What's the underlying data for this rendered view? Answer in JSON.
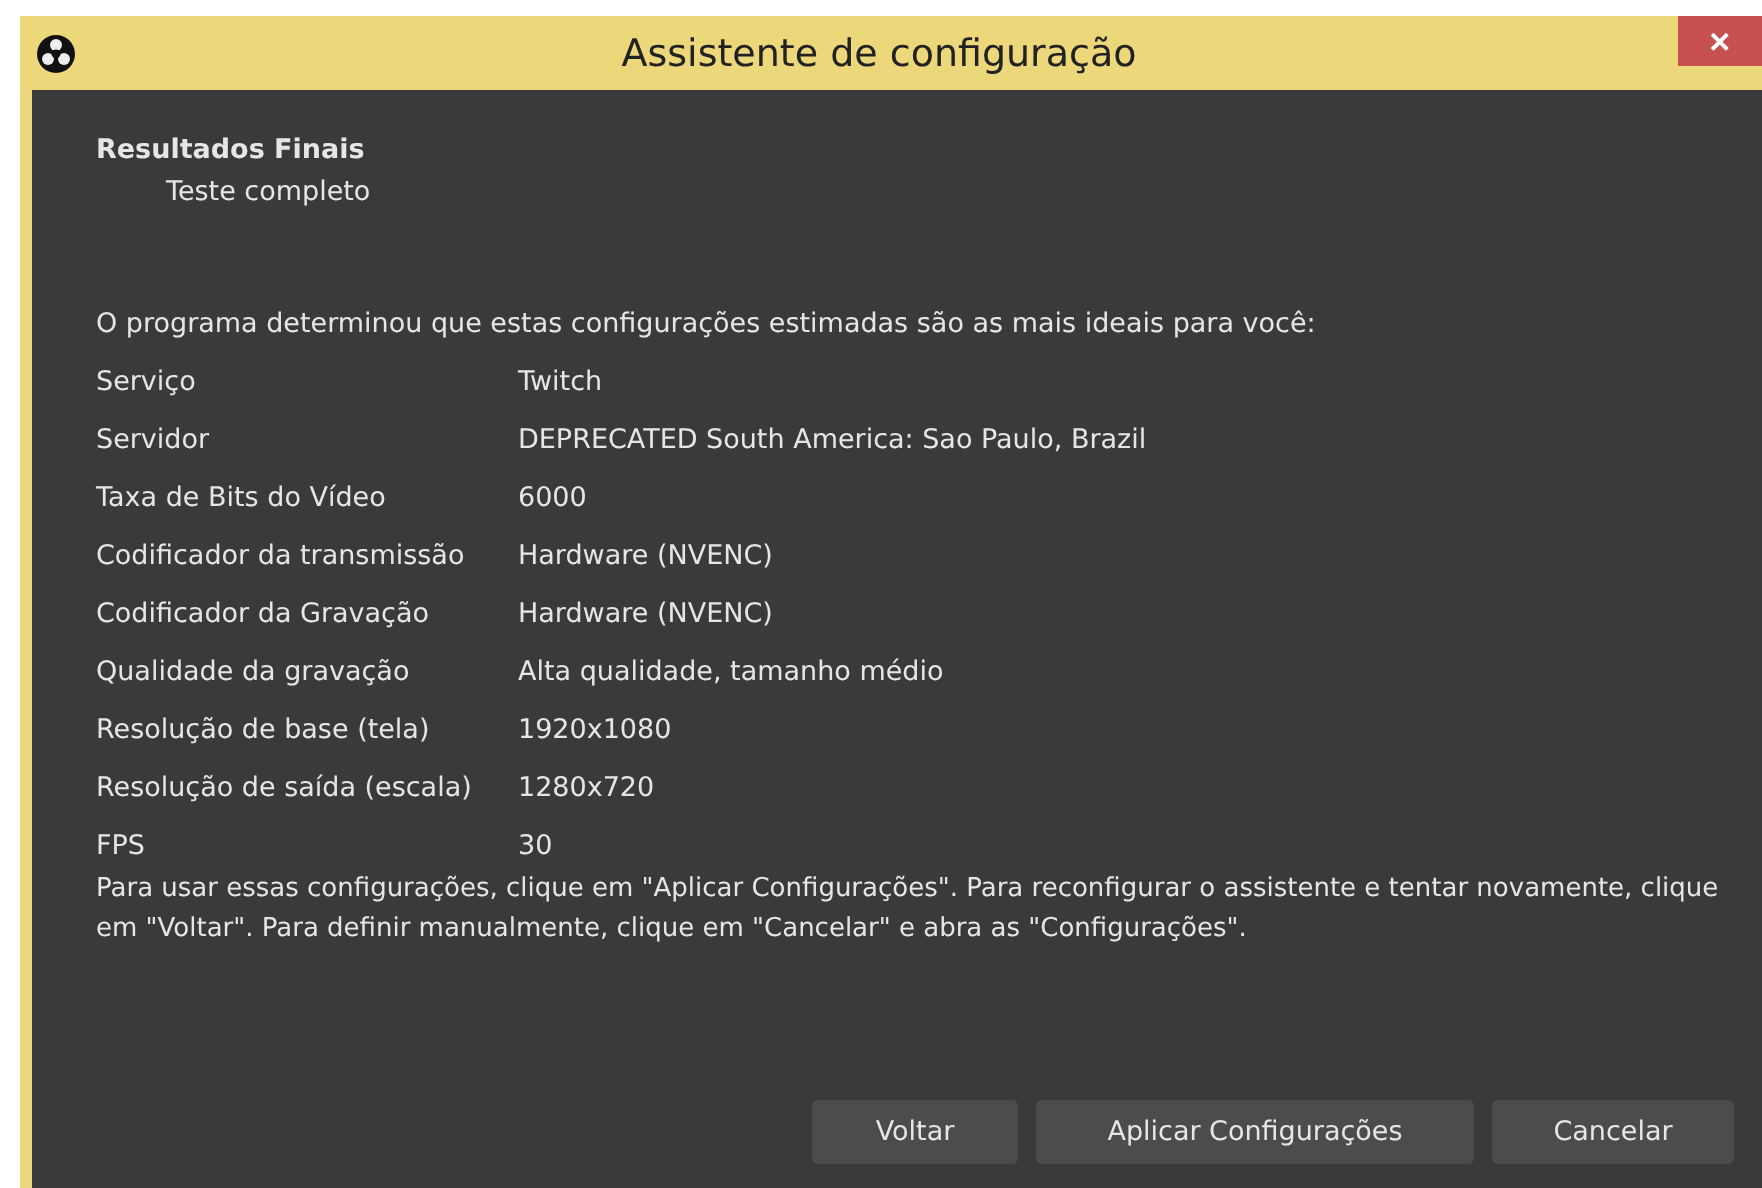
{
  "window": {
    "title": "Assistente de configuração"
  },
  "header": {
    "title": "Resultados Finais",
    "subtitle": "Teste completo"
  },
  "intro": "O programa determinou que estas configurações estimadas são as mais ideais para você:",
  "settings": [
    {
      "label": "Serviço",
      "value": "Twitch"
    },
    {
      "label": "Servidor",
      "value": "DEPRECATED South America: Sao Paulo, Brazil"
    },
    {
      "label": "Taxa de Bits do Vídeo",
      "value": "6000"
    },
    {
      "label": "Codificador da transmissão",
      "value": "Hardware (NVENC)"
    },
    {
      "label": "Codificador da Gravação",
      "value": "Hardware (NVENC)"
    },
    {
      "label": "Qualidade da gravação",
      "value": "Alta qualidade, tamanho médio"
    },
    {
      "label": "Resolução de base (tela)",
      "value": "1920x1080"
    },
    {
      "label": "Resolução de saída (escala)",
      "value": "1280x720"
    },
    {
      "label": "FPS",
      "value": "30"
    }
  ],
  "note": "Para usar essas configurações, clique em \"Aplicar Configurações\". Para reconfigurar o assistente e tentar novamente, clique em \"Voltar\". Para definir manualmente, clique em \"Cancelar\" e abra as \"Configurações\".",
  "buttons": [
    "Voltar",
    "Aplicar Configurações",
    "Cancelar"
  ],
  "close_button": "✕"
}
